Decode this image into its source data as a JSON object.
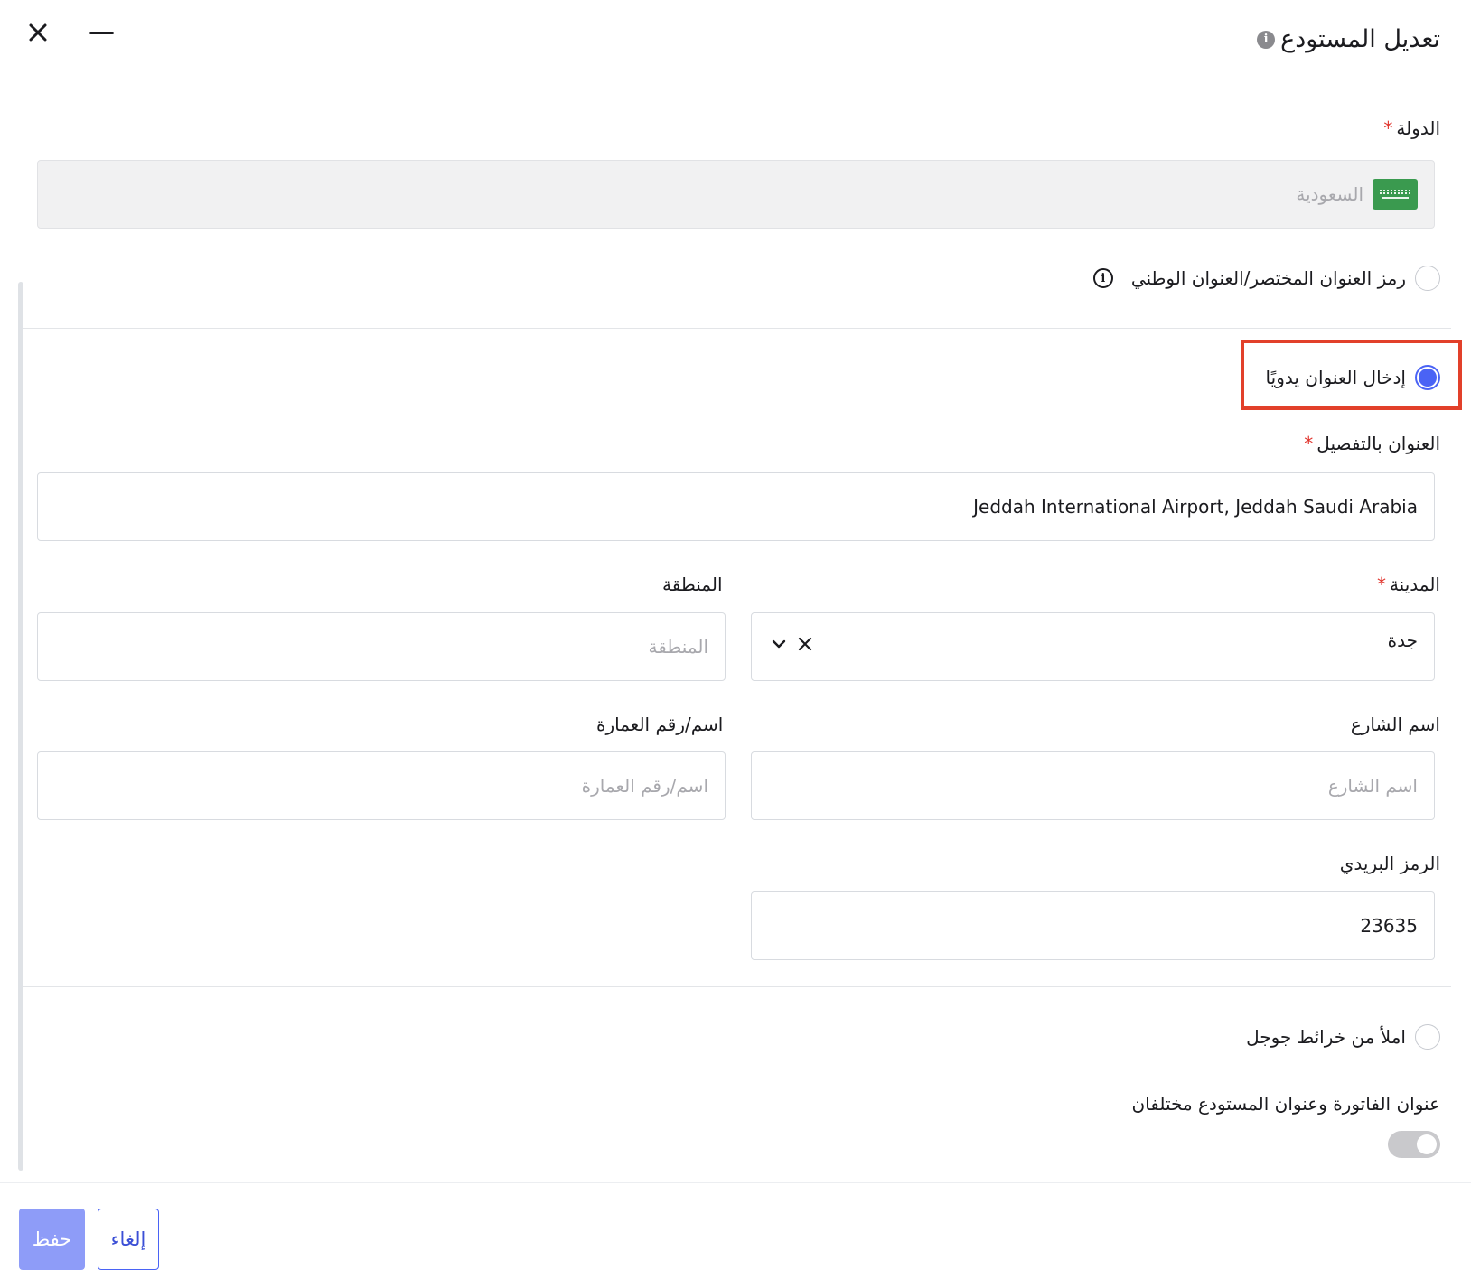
{
  "header": {
    "title": "تعديل المستودع",
    "info_icon": "info-icon",
    "close_icon": "close-icon",
    "minimize_icon": "minimize-icon"
  },
  "country": {
    "label": "الدولة",
    "required_mark": "*",
    "value": "السعودية",
    "flag_icon": "saudi-flag-icon"
  },
  "address_options": {
    "short_code_label": "رمز العنوان المختصر/العنوان الوطني",
    "manual_label": "إدخال العنوان يدويًا",
    "google_maps_label": "املأ من خرائط جوجل",
    "selected": "manual"
  },
  "detailed_address": {
    "label": "العنوان بالتفصيل",
    "required_mark": "*",
    "value": "Jeddah International Airport, Jeddah Saudi Arabia"
  },
  "city": {
    "label": "المدينة",
    "required_mark": "*",
    "value": "جدة"
  },
  "region": {
    "label": "المنطقة",
    "placeholder": "المنطقة"
  },
  "street": {
    "label": "اسم الشارع",
    "placeholder": "اسم الشارع"
  },
  "building": {
    "label": "اسم/رقم العمارة",
    "placeholder": "اسم/رقم العمارة"
  },
  "postal_code": {
    "label": "الرمز البريدي",
    "value": "23635"
  },
  "billing_toggle": {
    "label": "عنوان الفاتورة وعنوان المستودع مختلفان",
    "enabled": false
  },
  "footer": {
    "save_label": "حفظ",
    "cancel_label": "إلغاء"
  },
  "colors": {
    "accent": "#4a63f5",
    "save_button": "#8e9cf8",
    "required": "#e0322b",
    "highlight_box": "#e2402a"
  }
}
